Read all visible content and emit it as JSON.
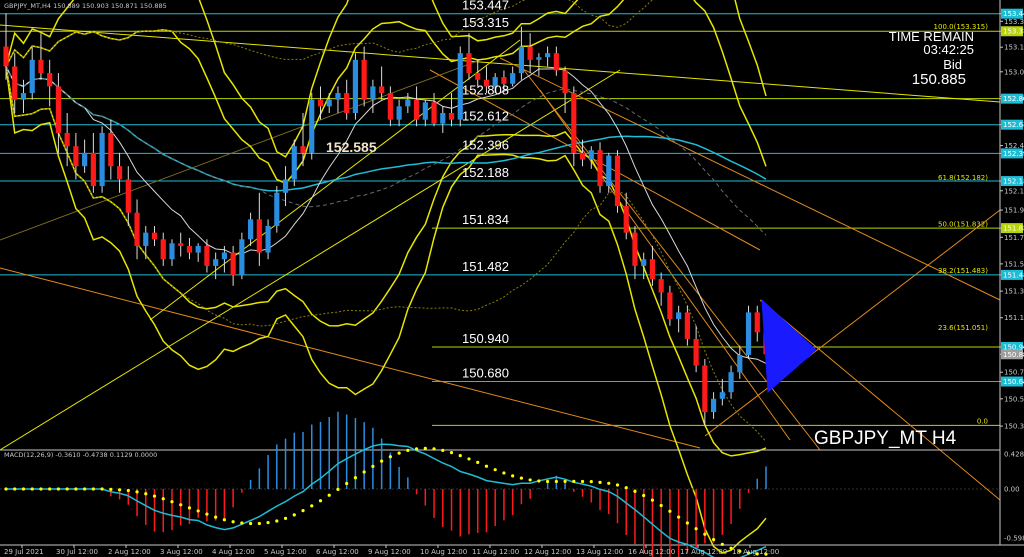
{
  "header": {
    "symbol_line": "GBPJPY_MT,H4  150.889 150.903 150.871 150.885",
    "macd_line": "MACD(12,26,9) -0.3610 -0.4738 0.1129 0.0000"
  },
  "overlay": {
    "time_remain_label": "TIME REMAIN",
    "time_remain": "03:42:25",
    "bid_label": "Bid",
    "bid": "150.885",
    "watermark": "GBPJPY_MT H4",
    "marker_price": "152.585"
  },
  "colors": {
    "background": "#000000",
    "bull": "#2a8de0",
    "bear": "#ff1a1a",
    "bollinger": "#e6e600",
    "trendline": "#e08a1e",
    "level": "#b8d40a",
    "cyan_level": "#1fbcd6",
    "macd_signal": "#ffff00",
    "macd_line": "#1fbcd6"
  },
  "chart_data": {
    "type": "candlestick",
    "title": "GBPJPY_MT H4",
    "ylim": [
      150.18,
      153.55
    ],
    "y_ticks": [
      "153.447",
      "153.390",
      "153.315",
      "153.195",
      "153.010",
      "152.808",
      "152.825",
      "152.612",
      "152.455",
      "152.396",
      "152.188",
      "152.115",
      "151.970",
      "151.834",
      "151.765",
      "151.565",
      "151.482",
      "151.360",
      "151.160",
      "150.940",
      "150.885",
      "150.750",
      "150.680",
      "150.550",
      "150.345"
    ],
    "x_labels": [
      "29 Jul 2021",
      "30 Jul 12:00",
      "2 Aug 12:00",
      "3 Aug 12:00",
      "4 Aug 12:00",
      "5 Aug 12:00",
      "6 Aug 12:00",
      "9 Aug 12:00",
      "10 Aug 12:00",
      "11 Aug 12:00",
      "12 Aug 12:00",
      "13 Aug 12:00",
      "16 Aug 12:00",
      "17 Aug 12:00",
      "18 Aug 12:00"
    ],
    "price_levels": [
      {
        "value": 153.447,
        "label": "153.447"
      },
      {
        "value": 153.315,
        "label": "153.315"
      },
      {
        "value": 152.808,
        "label": "152.808"
      },
      {
        "value": 152.612,
        "label": "152.612"
      },
      {
        "value": 152.396,
        "label": "152.396"
      },
      {
        "value": 152.188,
        "label": "152.188"
      },
      {
        "value": 151.834,
        "label": "151.834"
      },
      {
        "value": 151.482,
        "label": "151.482"
      },
      {
        "value": 150.94,
        "label": "150.940"
      },
      {
        "value": 150.68,
        "label": "150.680"
      }
    ],
    "axis_boxes": [
      {
        "value": 153.447,
        "label": "153.447"
      },
      {
        "value": 153.315,
        "label": "153.315"
      },
      {
        "value": 152.808,
        "label": "152.808"
      },
      {
        "value": 152.612,
        "label": "152.612"
      },
      {
        "value": 152.396,
        "label": "152.396"
      },
      {
        "value": 152.188,
        "label": "152.188"
      },
      {
        "value": 151.834,
        "label": "151.834"
      },
      {
        "value": 151.482,
        "label": "151.482"
      },
      {
        "value": 150.94,
        "label": "150.940"
      },
      {
        "value": 150.885,
        "label": "150.885"
      },
      {
        "value": 150.68,
        "label": "150.680"
      }
    ],
    "fib_labels": [
      {
        "value": 153.315,
        "label": "100.0(153.315)"
      },
      {
        "value": 152.182,
        "label": "61.8(152.182)"
      },
      {
        "value": 151.832,
        "label": "50.0(151.832)"
      },
      {
        "value": 151.483,
        "label": "38.2(151.483)"
      },
      {
        "value": 151.051,
        "label": "23.6(151.051)"
      },
      {
        "value": 150.35,
        "label": "0.0"
      }
    ],
    "macd": {
      "ylim": [
        -0.62,
        0.45
      ],
      "y_ticks": [
        "0.4284",
        "0.00",
        "-0.5985"
      ]
    },
    "candles": [
      [
        153.2,
        153.45,
        152.95,
        153.05
      ],
      [
        153.05,
        153.15,
        152.7,
        152.8
      ],
      [
        152.8,
        152.95,
        152.7,
        152.85
      ],
      [
        152.85,
        153.2,
        152.8,
        153.1
      ],
      [
        153.1,
        153.3,
        152.95,
        153.0
      ],
      [
        153.0,
        153.1,
        152.75,
        152.9
      ],
      [
        152.9,
        153.0,
        152.4,
        152.55
      ],
      [
        152.55,
        152.7,
        152.3,
        152.45
      ],
      [
        152.45,
        152.55,
        152.2,
        152.3
      ],
      [
        152.3,
        152.5,
        152.25,
        152.4
      ],
      [
        152.4,
        152.55,
        152.1,
        152.15
      ],
      [
        152.15,
        152.6,
        152.1,
        152.55
      ],
      [
        152.55,
        152.65,
        152.2,
        152.3
      ],
      [
        152.3,
        152.4,
        152.1,
        152.2
      ],
      [
        152.2,
        152.3,
        151.85,
        151.95
      ],
      [
        151.95,
        152.05,
        151.6,
        151.7
      ],
      [
        151.7,
        151.85,
        151.6,
        151.8
      ],
      [
        151.8,
        151.85,
        151.7,
        151.75
      ],
      [
        151.75,
        151.8,
        151.55,
        151.6
      ],
      [
        151.6,
        151.75,
        151.55,
        151.72
      ],
      [
        151.72,
        151.8,
        151.62,
        151.7
      ],
      [
        151.7,
        151.76,
        151.6,
        151.65
      ],
      [
        151.65,
        151.72,
        151.58,
        151.7
      ],
      [
        151.7,
        151.75,
        151.5,
        151.55
      ],
      [
        151.55,
        151.65,
        151.45,
        151.6
      ],
      [
        151.6,
        151.7,
        151.5,
        151.65
      ],
      [
        151.65,
        151.7,
        151.4,
        151.48
      ],
      [
        151.48,
        151.8,
        151.45,
        151.75
      ],
      [
        151.75,
        151.95,
        151.7,
        151.9
      ],
      [
        151.9,
        152.1,
        151.55,
        151.65
      ],
      [
        151.65,
        151.9,
        151.6,
        151.85
      ],
      [
        151.85,
        152.15,
        151.8,
        152.1
      ],
      [
        152.1,
        152.3,
        152.0,
        152.2
      ],
      [
        152.2,
        152.5,
        152.15,
        152.45
      ],
      [
        152.45,
        152.7,
        152.3,
        152.4
      ],
      [
        152.4,
        152.85,
        152.35,
        152.8
      ],
      [
        152.8,
        152.9,
        152.65,
        152.75
      ],
      [
        152.75,
        152.85,
        152.7,
        152.8
      ],
      [
        152.8,
        152.9,
        152.7,
        152.85
      ],
      [
        152.85,
        152.95,
        152.65,
        152.7
      ],
      [
        152.7,
        153.15,
        152.65,
        153.1
      ],
      [
        153.1,
        153.2,
        152.75,
        152.8
      ],
      [
        152.8,
        152.95,
        152.7,
        152.9
      ],
      [
        152.9,
        153.05,
        152.8,
        152.85
      ],
      [
        152.85,
        152.9,
        152.6,
        152.65
      ],
      [
        152.65,
        152.8,
        152.6,
        152.75
      ],
      [
        152.75,
        152.85,
        152.7,
        152.8
      ],
      [
        152.8,
        152.9,
        152.6,
        152.65
      ],
      [
        152.65,
        152.8,
        152.6,
        152.78
      ],
      [
        152.78,
        152.85,
        152.6,
        152.62
      ],
      [
        152.62,
        152.75,
        152.55,
        152.7
      ],
      [
        152.7,
        152.85,
        152.6,
        152.65
      ],
      [
        152.65,
        153.2,
        152.6,
        153.15
      ],
      [
        153.15,
        153.3,
        152.95,
        153.0
      ],
      [
        153.0,
        153.1,
        152.9,
        152.95
      ],
      [
        152.95,
        153.05,
        152.85,
        152.9
      ],
      [
        152.9,
        153.0,
        152.85,
        152.97
      ],
      [
        152.97,
        153.02,
        152.88,
        152.92
      ],
      [
        152.92,
        153.05,
        152.9,
        153.0
      ],
      [
        153.0,
        153.35,
        152.95,
        153.2
      ],
      [
        153.2,
        153.3,
        153.0,
        153.1
      ],
      [
        153.1,
        153.15,
        152.98,
        153.12
      ],
      [
        153.12,
        153.2,
        153.05,
        153.15
      ],
      [
        153.15,
        153.2,
        152.98,
        153.02
      ],
      [
        153.02,
        153.05,
        152.7,
        152.85
      ],
      [
        152.85,
        152.9,
        152.3,
        152.4
      ],
      [
        152.4,
        152.5,
        152.3,
        152.35
      ],
      [
        152.35,
        152.45,
        152.28,
        152.42
      ],
      [
        152.42,
        152.48,
        152.1,
        152.15
      ],
      [
        152.15,
        152.4,
        152.1,
        152.38
      ],
      [
        152.38,
        152.42,
        151.95,
        152.0
      ],
      [
        152.0,
        152.1,
        151.75,
        151.8
      ],
      [
        151.8,
        151.85,
        151.45,
        151.55
      ],
      [
        151.55,
        151.65,
        151.45,
        151.6
      ],
      [
        151.6,
        151.7,
        151.4,
        151.45
      ],
      [
        151.45,
        151.5,
        151.25,
        151.35
      ],
      [
        151.35,
        151.4,
        151.1,
        151.15
      ],
      [
        151.15,
        151.25,
        151.05,
        151.2
      ],
      [
        151.2,
        151.25,
        150.95,
        151.0
      ],
      [
        151.0,
        151.1,
        150.75,
        150.8
      ],
      [
        150.8,
        150.85,
        150.35,
        150.45
      ],
      [
        150.45,
        150.6,
        150.4,
        150.55
      ],
      [
        150.55,
        150.7,
        150.5,
        150.6
      ],
      [
        150.6,
        150.8,
        150.55,
        150.75
      ],
      [
        150.75,
        150.95,
        150.7,
        150.88
      ],
      [
        150.88,
        151.25,
        150.85,
        151.2
      ],
      [
        151.2,
        151.25,
        150.98,
        151.05
      ],
      [
        151.05,
        151.12,
        150.85,
        150.885
      ]
    ]
  }
}
